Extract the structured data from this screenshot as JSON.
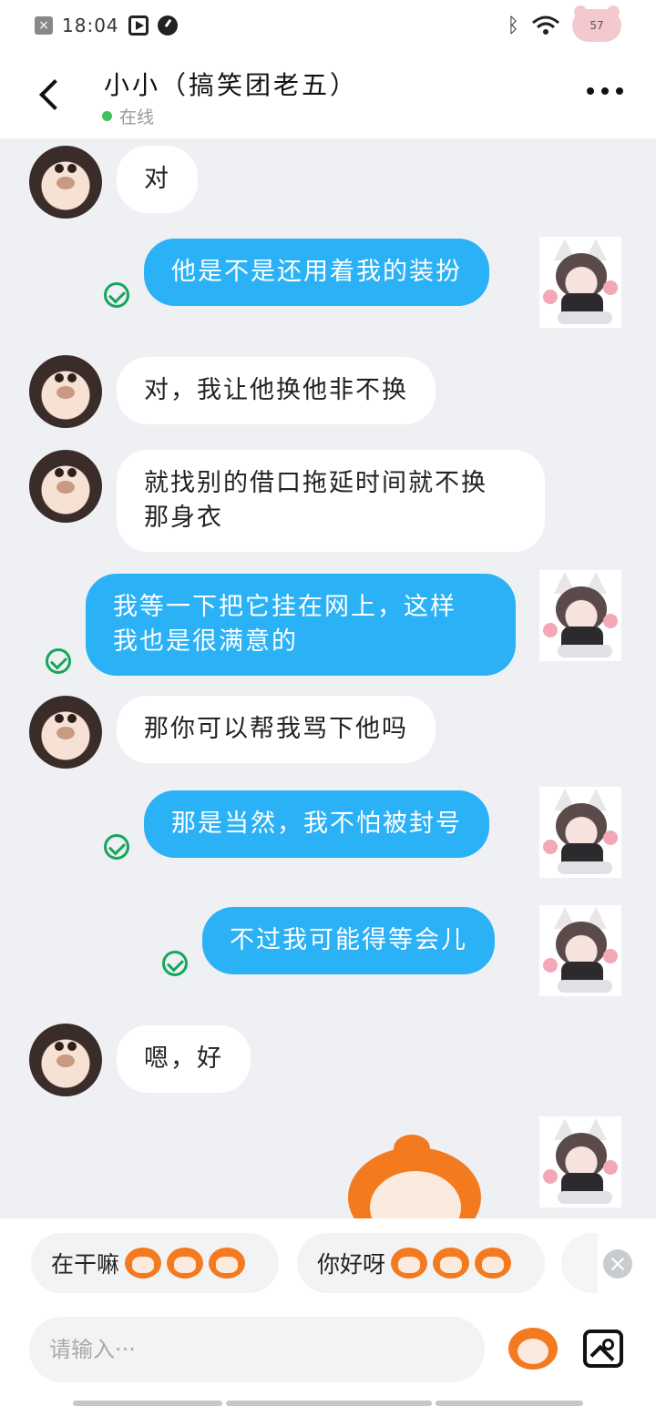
{
  "status_bar": {
    "time": "18:04",
    "notification_icon": "x-icon",
    "bluetooth_icon": "bluetooth-icon",
    "battery_level": "57"
  },
  "header": {
    "title": "小小（搞笑团老五）",
    "status": "在线",
    "status_color": "#3cc25e"
  },
  "messages": [
    {
      "side": "in",
      "text": "对"
    },
    {
      "side": "out",
      "text": "他是不是还用着我的装扮",
      "read": true
    },
    {
      "side": "in",
      "text": "对，我让他换他非不换"
    },
    {
      "side": "in",
      "text": "就找别的借口拖延时间就不换\n那身衣"
    },
    {
      "side": "out",
      "text": "我等一下把它挂在网上，这样\n我也是很满意的",
      "read": true
    },
    {
      "side": "in",
      "text": "那你可以帮我骂下他吗"
    },
    {
      "side": "out",
      "text": "那是当然，我不怕被封号",
      "read": true
    },
    {
      "side": "out",
      "text": "不过我可能得等会儿",
      "read": true
    },
    {
      "side": "in",
      "text": "嗯，好"
    },
    {
      "side": "out",
      "type": "sticker",
      "sticker": "orange-monkey-sticker"
    }
  ],
  "quick_replies": [
    {
      "text": "在干嘛",
      "emoji": "grin-monkey-emoji"
    },
    {
      "text": "你好呀",
      "emoji": "wave-monkey-emoji"
    }
  ],
  "input": {
    "placeholder": "请输入···",
    "value": ""
  },
  "colors": {
    "outgoing_bubble": "#2bb1f5",
    "incoming_bubble": "#ffffff",
    "read_check": "#16a65a",
    "background": "#eef0f4"
  }
}
